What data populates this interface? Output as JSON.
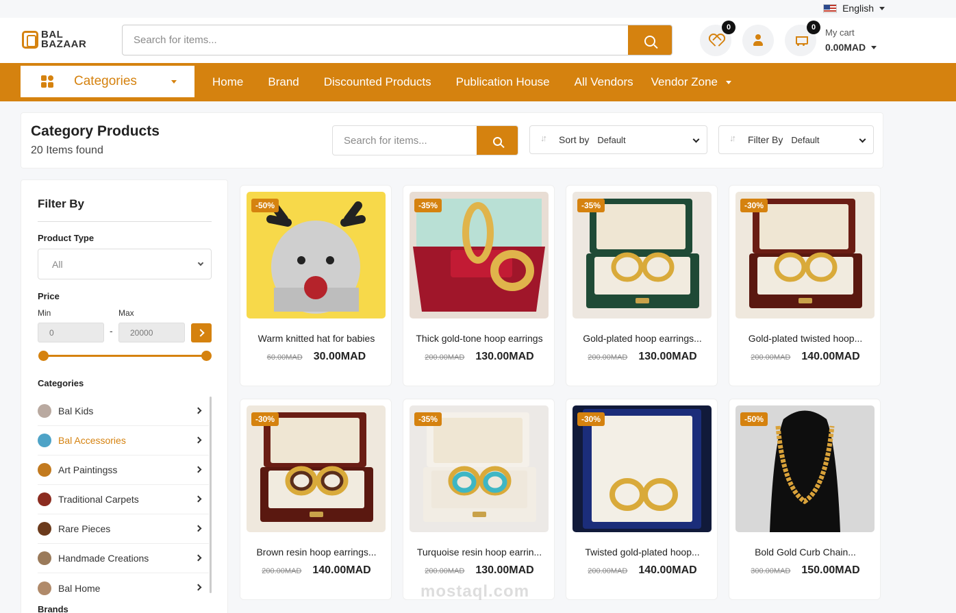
{
  "lang": {
    "label": "English"
  },
  "logo": {
    "line1": "BAL",
    "line2": "BAZAAR"
  },
  "search": {
    "placeholder": "Search for items..."
  },
  "wishlist": {
    "count": "0"
  },
  "cart": {
    "count": "0",
    "label": "My cart",
    "total": "0.00MAD"
  },
  "nav": {
    "categories_label": "Categories",
    "links": [
      "Home",
      "Brand",
      "Discounted Products",
      "Publication House",
      "All Vendors",
      "Vendor Zone"
    ]
  },
  "catpanel": {
    "title": "Category Products",
    "count": "20 Items found",
    "search_placeholder": "Search for items...",
    "sort_label": "Sort by",
    "sort_value": "Default",
    "filter_label": "Filter By",
    "filter_value": "Default"
  },
  "sidebar": {
    "title": "Filter By",
    "product_type_label": "Product Type",
    "product_type_value": "All",
    "price_label": "Price",
    "min_label": "Min",
    "max_label": "Max",
    "min_value": "0",
    "dash": "-",
    "max_value": "20000",
    "categories_label": "Categories",
    "categories": [
      {
        "name": "Bal Kids",
        "color": "#b9a9a0",
        "active": false
      },
      {
        "name": "Bal Accessories",
        "color": "#4ea3c7",
        "active": true
      },
      {
        "name": "Art Paintingss",
        "color": "#c27a1f",
        "active": false
      },
      {
        "name": "Traditional Carpets",
        "color": "#8b2c20",
        "active": false
      },
      {
        "name": "Rare Pieces",
        "color": "#6b3a1c",
        "active": false
      },
      {
        "name": "Handmade Creations",
        "color": "#9a7a5a",
        "active": false
      },
      {
        "name": "Bal Home",
        "color": "#b08a6a",
        "active": false
      }
    ],
    "brands_label": "Brands"
  },
  "products": [
    {
      "name": "Warm knitted hat for babies",
      "old": "60.00MAD",
      "price": "30.00MAD",
      "discount": "-50%",
      "img": "hat"
    },
    {
      "name": "Thick gold-tone hoop earrings",
      "old": "200.00MAD",
      "price": "130.00MAD",
      "discount": "-35%",
      "img": "redbox"
    },
    {
      "name": "Gold-plated hoop earrings...",
      "old": "200.00MAD",
      "price": "130.00MAD",
      "discount": "-35%",
      "img": "greenbox"
    },
    {
      "name": "Gold-plated twisted hoop...",
      "old": "200.00MAD",
      "price": "140.00MAD",
      "discount": "-30%",
      "img": "woodbox"
    },
    {
      "name": "Brown resin hoop earrings...",
      "old": "200.00MAD",
      "price": "140.00MAD",
      "discount": "-30%",
      "img": "woodbox2"
    },
    {
      "name": "Turquoise resin hoop earrin...",
      "old": "200.00MAD",
      "price": "130.00MAD",
      "discount": "-35%",
      "img": "whitebox"
    },
    {
      "name": "Twisted gold-plated hoop...",
      "old": "200.00MAD",
      "price": "140.00MAD",
      "discount": "-30%",
      "img": "bluebox"
    },
    {
      "name": "Bold Gold Curb Chain...",
      "old": "300.00MAD",
      "price": "150.00MAD",
      "discount": "-50%",
      "img": "necklace"
    }
  ],
  "watermark": "mostaql.com"
}
